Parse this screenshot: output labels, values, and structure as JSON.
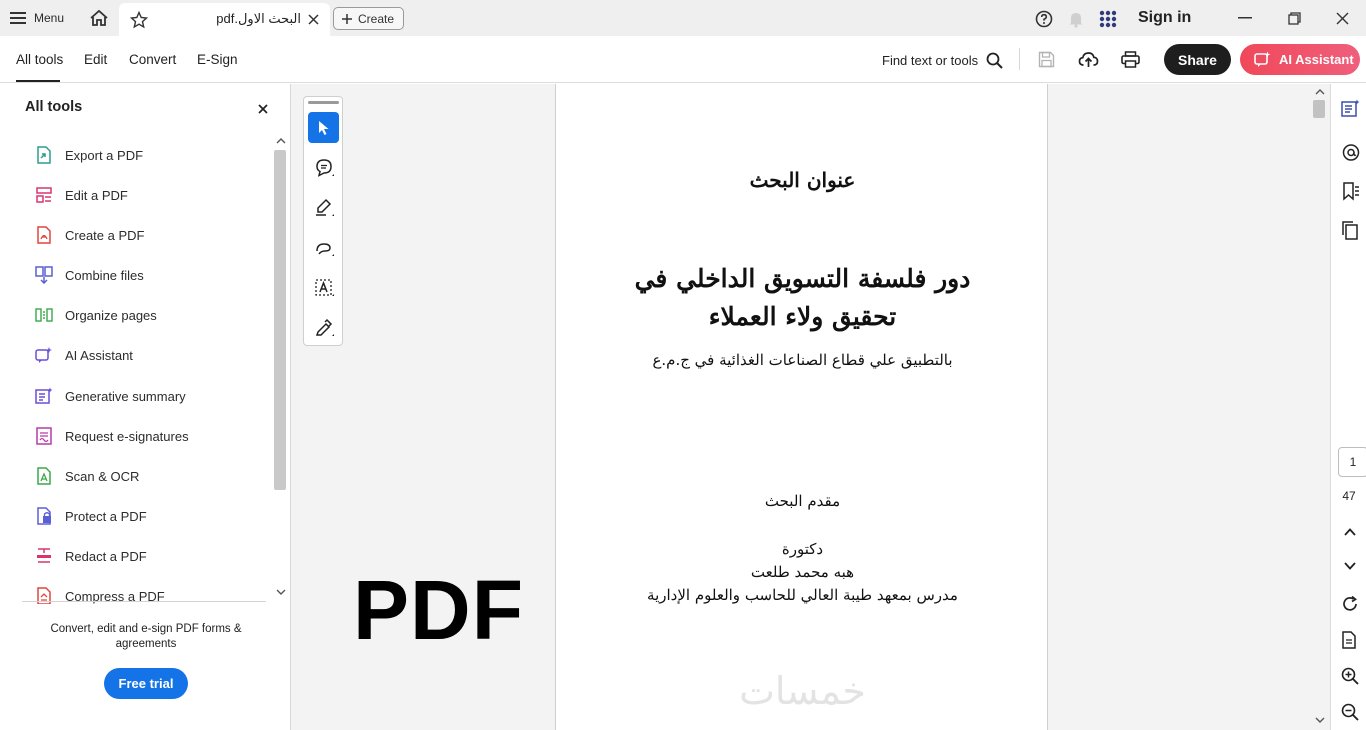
{
  "titlebar": {
    "menu_label": "Menu",
    "tab_title": "البحث الاول.pdf",
    "create_label": "Create",
    "sign_in": "Sign in"
  },
  "toolbar": {
    "tabs": [
      {
        "label": "All tools"
      },
      {
        "label": "Edit"
      },
      {
        "label": "Convert"
      },
      {
        "label": "E-Sign"
      }
    ],
    "find_label": "Find text or tools",
    "share_label": "Share",
    "ai_label": "AI Assistant"
  },
  "left_panel": {
    "title": "All tools",
    "tools": [
      {
        "label": "Export a PDF",
        "icon": "export-pdf-icon",
        "color": "#2a9d8f"
      },
      {
        "label": "Edit a PDF",
        "icon": "edit-pdf-icon",
        "color": "#d8356f"
      },
      {
        "label": "Create a PDF",
        "icon": "create-pdf-icon",
        "color": "#e0443c"
      },
      {
        "label": "Combine files",
        "icon": "combine-files-icon",
        "color": "#5b5fd6"
      },
      {
        "label": "Organize pages",
        "icon": "organize-pages-icon",
        "color": "#3aa84a"
      },
      {
        "label": "AI Assistant",
        "icon": "ai-assistant-icon",
        "color": "#6a4fd8"
      },
      {
        "label": "Generative summary",
        "icon": "generative-summary-icon",
        "color": "#6a4fd8"
      },
      {
        "label": "Request e-signatures",
        "icon": "request-esignatures-icon",
        "color": "#b73aa9"
      },
      {
        "label": "Scan & OCR",
        "icon": "scan-ocr-icon",
        "color": "#3aa84a"
      },
      {
        "label": "Protect a PDF",
        "icon": "protect-pdf-icon",
        "color": "#5b5fd6"
      },
      {
        "label": "Redact a PDF",
        "icon": "redact-pdf-icon",
        "color": "#d8356f"
      },
      {
        "label": "Compress a PDF",
        "icon": "compress-pdf-icon",
        "color": "#e0443c"
      }
    ],
    "promo_text": "Convert, edit and e-sign PDF forms & agreements",
    "trial_label": "Free trial"
  },
  "document": {
    "heading_label": "عنوان البحث",
    "title_line1": "دور فلسفة التسويق الداخلي في",
    "title_line2": "تحقيق ولاء العملاء",
    "subtitle": "بالتطبيق علي قطاع الصناعات الغذائية في ج.م.ع",
    "presenter_label": "مقدم البحث",
    "degree": "دكتورة",
    "author": "هبه محمد طلعت",
    "affiliation": "مدرس بمعهد طيبة العالي للحاسب والعلوم الإدارية",
    "pdf_logo_text": "PDF",
    "watermark": "خمسات"
  },
  "page_nav": {
    "current_page": "1",
    "total_pages": "47"
  },
  "colors": {
    "accent_blue": "#1473e6",
    "selection_blue": "#1473e6",
    "ai_gradient": "#f0485a"
  }
}
